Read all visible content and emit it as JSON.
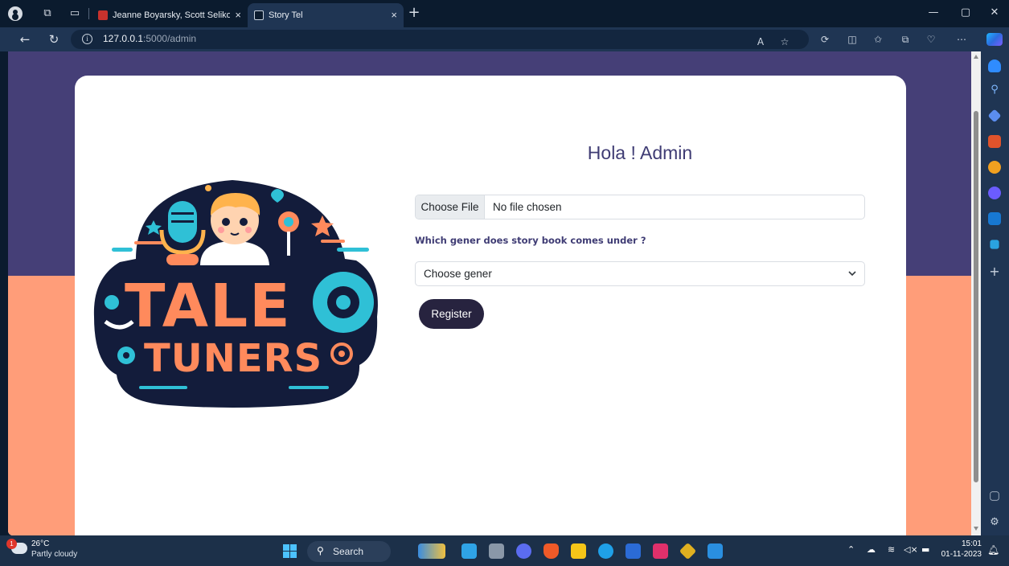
{
  "browser": {
    "tabs": [
      {
        "title": "Jeanne Boyarsky, Scott Selikoff - ",
        "close": "×"
      },
      {
        "title": "Story Tel",
        "close": "×"
      }
    ],
    "new_tab": "+",
    "url_host": "127.0.0.1",
    "url_path": ":5000/admin",
    "window_controls": {
      "minimize": "—",
      "maximize": "▢",
      "close": "✕"
    }
  },
  "page": {
    "title": "Hola ! Admin",
    "file_input": {
      "button": "Choose File",
      "status": "No file chosen"
    },
    "genre_question": "Which gener does story book comes under ?",
    "genre_select": {
      "selected": "Choose gener"
    },
    "register_label": "Register",
    "logo": {
      "line1": "TALE",
      "line2": "TUNERS"
    },
    "colors": {
      "header_band": "#453f77",
      "lower_band": "#ff9d79",
      "button": "#27233f",
      "title": "#3f3c74"
    }
  },
  "taskbar": {
    "weather_badge": "1",
    "temperature": "26°C",
    "condition": "Partly cloudy",
    "search_label": "Search",
    "time": "15:01",
    "date": "01-11-2023"
  }
}
